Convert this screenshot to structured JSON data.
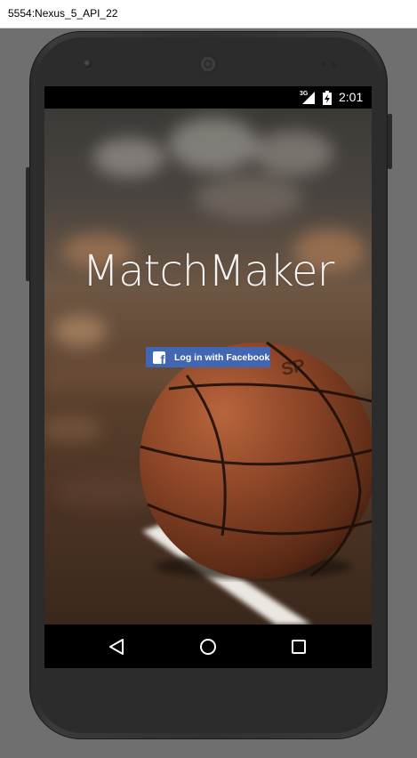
{
  "window": {
    "title": "5554:Nexus_5_API_22"
  },
  "status_bar": {
    "network": "3G",
    "time": "2:01",
    "icons": [
      "signal-icon",
      "battery-charging-icon"
    ]
  },
  "app": {
    "title": "MatchMaker",
    "login_button": {
      "label": "Log in with Facebook",
      "icon": "facebook-icon",
      "logo_glyph": "f",
      "color": "#4267b2"
    }
  },
  "nav_bar": {
    "buttons": [
      "back-icon",
      "home-icon",
      "recents-icon"
    ]
  }
}
